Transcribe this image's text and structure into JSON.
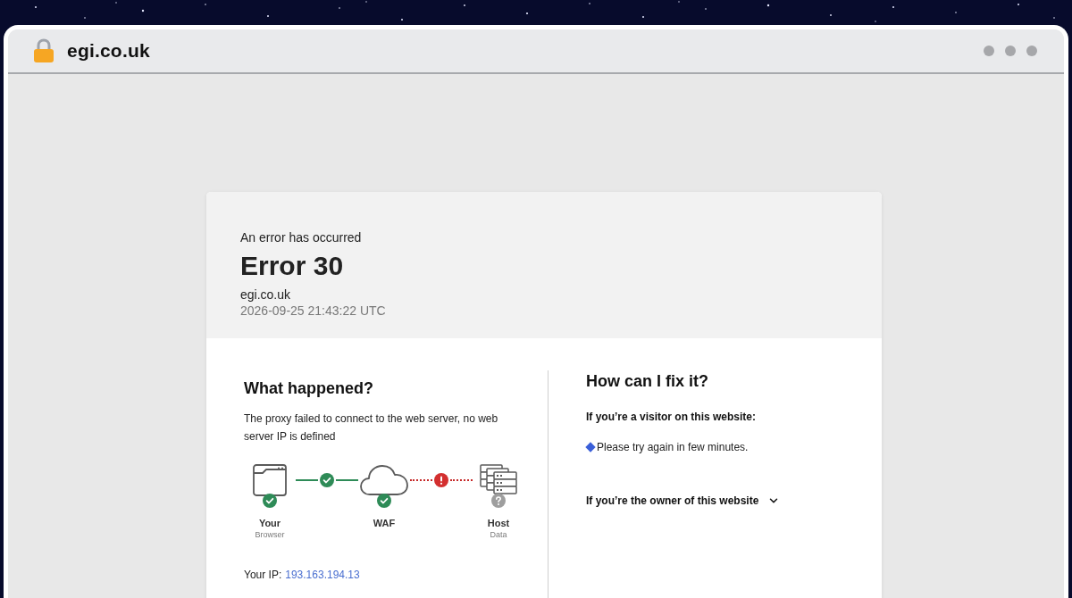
{
  "browser": {
    "address": "egi.co.uk"
  },
  "error": {
    "overline": "An error has occurred",
    "title": "Error 30",
    "host": "egi.co.uk",
    "timestamp": "2026-09-25 21:43:22 UTC"
  },
  "what_happened": {
    "heading": "What happened?",
    "description": "The proxy failed to connect to the web server, no web server IP is defined",
    "nodes": [
      {
        "kind": "browser",
        "label": "Your",
        "sublabel": "Browser",
        "ok": true
      },
      {
        "kind": "cloud",
        "label": "WAF",
        "ok": true
      },
      {
        "kind": "server",
        "label": "Host",
        "sublabel": "Data",
        "ok": false
      }
    ],
    "links": [
      {
        "failed": false
      },
      {
        "failed": true
      }
    ],
    "your_ip": {
      "label": "Your IP:",
      "value": "193.163.194.13"
    }
  },
  "fix": {
    "heading": "How can I fix it?",
    "visitor": {
      "title": "If you’re a visitor on this website:",
      "tips": [
        "Please try again in few minutes."
      ]
    },
    "owner": {
      "title": "If you’re the owner of this website",
      "expanded": false
    }
  }
}
